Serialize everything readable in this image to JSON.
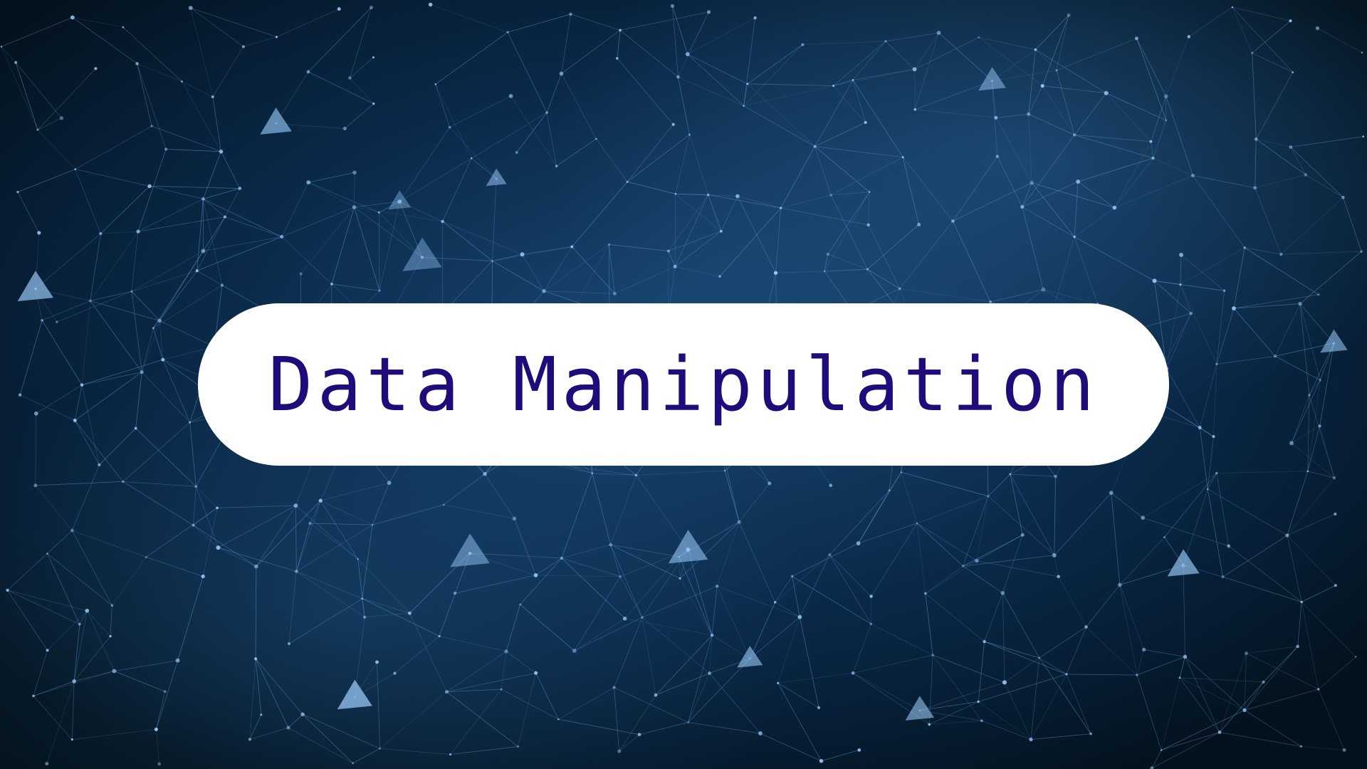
{
  "title": "Data Manipulation",
  "background": {
    "icon": "network-mesh",
    "color_dark": "#04131f",
    "color_mid": "#0e3a66",
    "color_glow": "#2f6fa6",
    "line_color": "#6aa8d8",
    "node_color": "#9fd0ff"
  },
  "pill": {
    "background": "#ffffff",
    "text_color": "#1f0b7a"
  }
}
